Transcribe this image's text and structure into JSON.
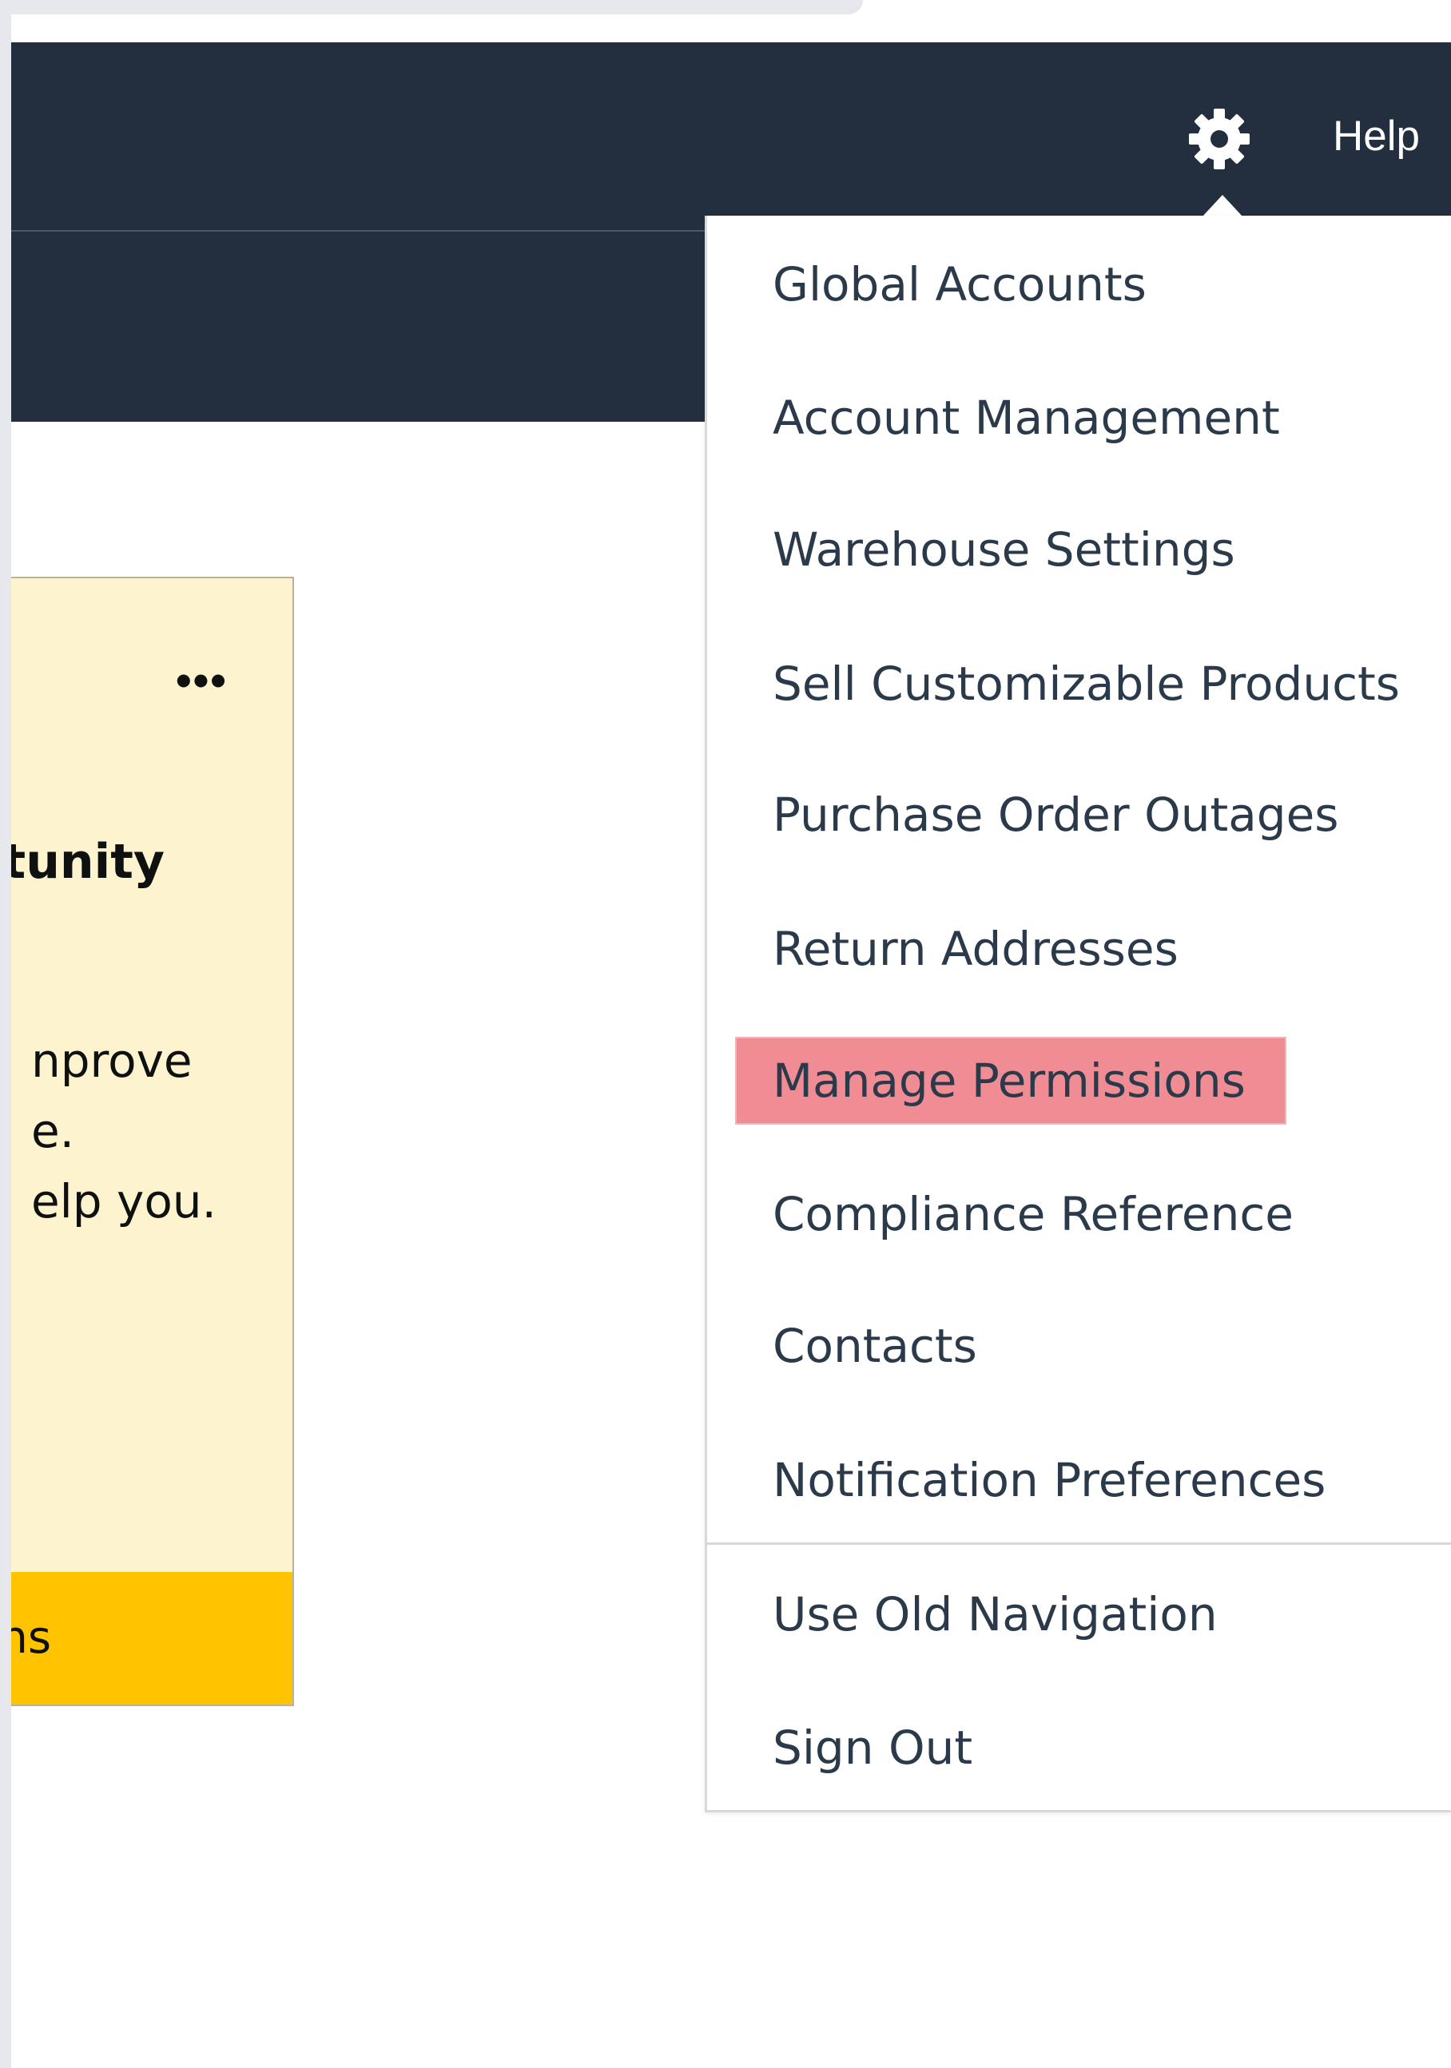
{
  "header": {
    "settings_icon": "gear-icon",
    "help_label": "Help"
  },
  "card": {
    "menu_icon": "more-horizontal-icon",
    "menu_glyph": "•••",
    "title": "tunity",
    "body_lines": [
      "nprove",
      "e.",
      "elp you."
    ],
    "button_label": "ns"
  },
  "settings_menu": {
    "items": [
      {
        "label": "Global Accounts"
      },
      {
        "label": "Account Management"
      },
      {
        "label": "Warehouse Settings"
      },
      {
        "label": "Sell Customizable Products"
      },
      {
        "label": "Purchase Order Outages"
      },
      {
        "label": "Return Addresses"
      },
      {
        "label": "Manage Permissions",
        "highlighted": true
      },
      {
        "label": "Compliance Reference"
      },
      {
        "label": "Contacts"
      },
      {
        "label": "Notification Preferences"
      }
    ],
    "secondary_items": [
      {
        "label": "Use Old Navigation"
      },
      {
        "label": "Sign Out"
      }
    ],
    "highlight_color": "#f08c94"
  },
  "colors": {
    "nav_background": "#232f3e",
    "card_background": "#fdf4cf",
    "card_button": "#ffc300"
  }
}
